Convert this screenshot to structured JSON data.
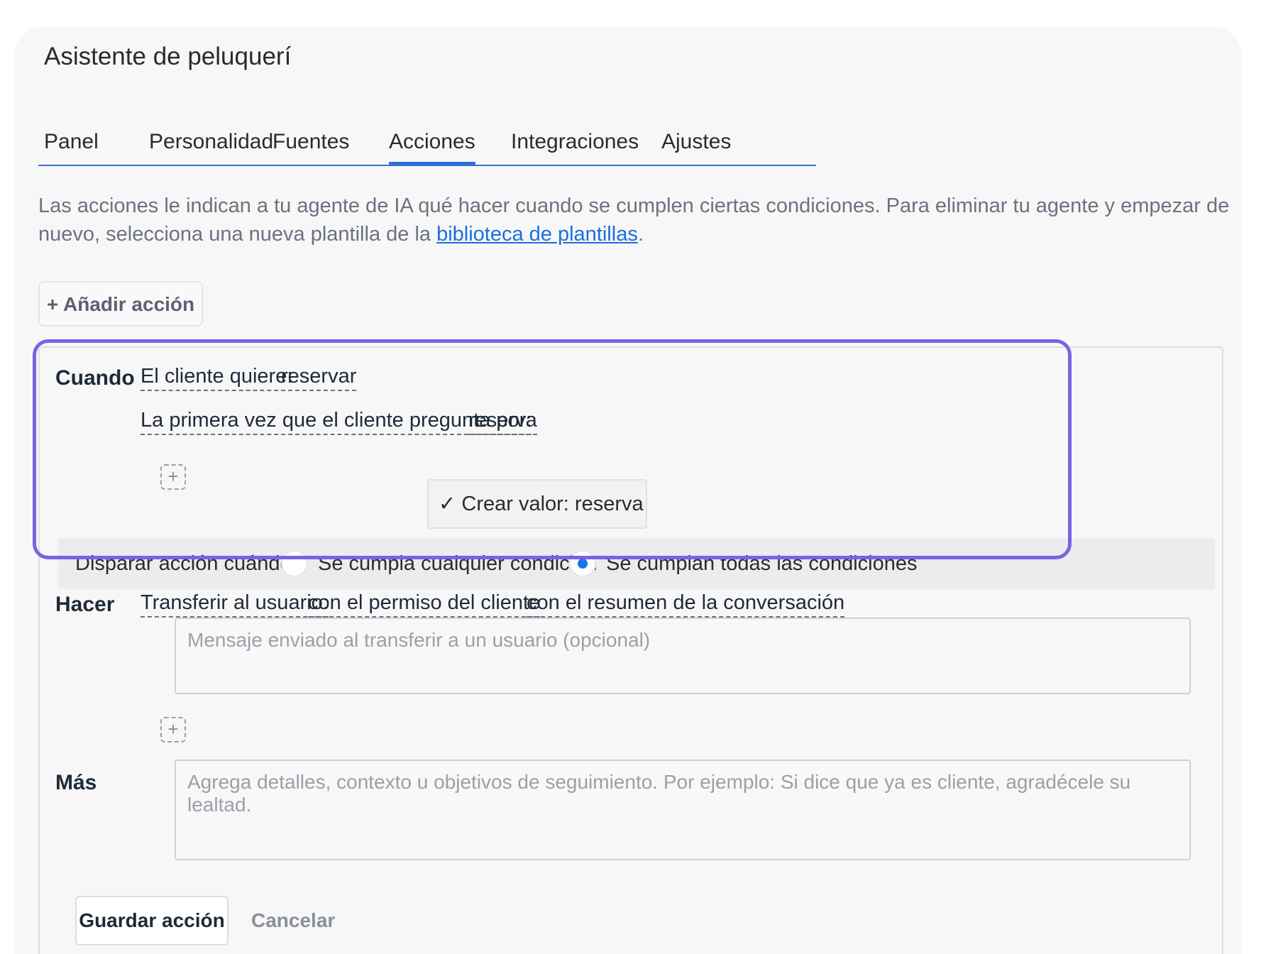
{
  "app": {
    "title": "Asistente de peluquerí"
  },
  "tabs": [
    {
      "label": "Panel"
    },
    {
      "label": "Personalidad"
    },
    {
      "label": "Fuentes"
    },
    {
      "label": "Acciones",
      "active": true
    },
    {
      "label": "Integraciones"
    },
    {
      "label": "Ajustes"
    }
  ],
  "intro": {
    "text": "Las acciones le indican a tu agente de IA qué hacer cuando se cumplen ciertas condiciones. Para eliminar tu agente y empezar de nuevo, selecciona una nueva plantilla de la ",
    "link": "biblioteca de plantillas",
    "end": "."
  },
  "add_action": {
    "label": "+ Añadir acción"
  },
  "when": {
    "label": "Cuando",
    "condition1": {
      "key": "El cliente quiere:",
      "value": "reservar"
    },
    "condition2": {
      "key": "La primera vez que el cliente pregunta por:",
      "value": "reserva"
    },
    "add_icon": "plus-icon",
    "suggestion": {
      "check": "✓",
      "label": "Crear valor: reserva"
    },
    "trigger": {
      "label": "Disparar acción cuándo:",
      "option_any": "Se cumpla cualquier condición",
      "option_all": "Se cumplan todas las condiciones",
      "selected": "all"
    }
  },
  "do": {
    "label": "Hacer",
    "action": "Transferir al usuario:",
    "option1": "con el permiso del cliente",
    "option2": "con el resumen de la conversación",
    "message_placeholder": "Mensaje enviado al transferir a un usuario (opcional)",
    "message_value": ""
  },
  "more": {
    "label": "Más",
    "placeholder": "Agrega detalles, contexto u objetivos de seguimiento. Por ejemplo: Si dice que ya es cliente, agradécele su lealtad.",
    "value": ""
  },
  "buttons": {
    "save": "Guardar acción",
    "cancel": "Cancelar"
  },
  "colors": {
    "accent": "#2f6fd8",
    "link": "#1a6fe0",
    "highlight": "#7b61e8",
    "radio_selected": "#1a73e8"
  }
}
